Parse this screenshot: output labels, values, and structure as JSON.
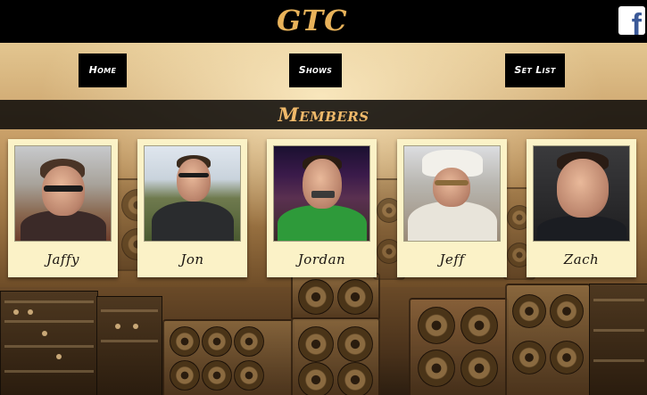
{
  "header": {
    "logo_text": "GTC",
    "facebook_icon": "facebook-icon",
    "facebook_glyph": "f"
  },
  "nav": {
    "home": "Home",
    "shows": "Shows",
    "set_list": "Set List"
  },
  "members": {
    "heading": "Members",
    "items": [
      {
        "name": "Jaffy",
        "photo": "member-photo"
      },
      {
        "name": "Jon",
        "photo": "member-photo"
      },
      {
        "name": "Jordan",
        "photo": "member-photo"
      },
      {
        "name": "Jeff",
        "photo": "member-photo"
      },
      {
        "name": "Zach",
        "photo": "member-photo"
      }
    ]
  },
  "colors": {
    "header_bg": "#000000",
    "logo": "#e8b25a",
    "members_heading": "#f0b96a",
    "card_bg": "#fbf2c7",
    "facebook_blue": "#3b5998"
  }
}
